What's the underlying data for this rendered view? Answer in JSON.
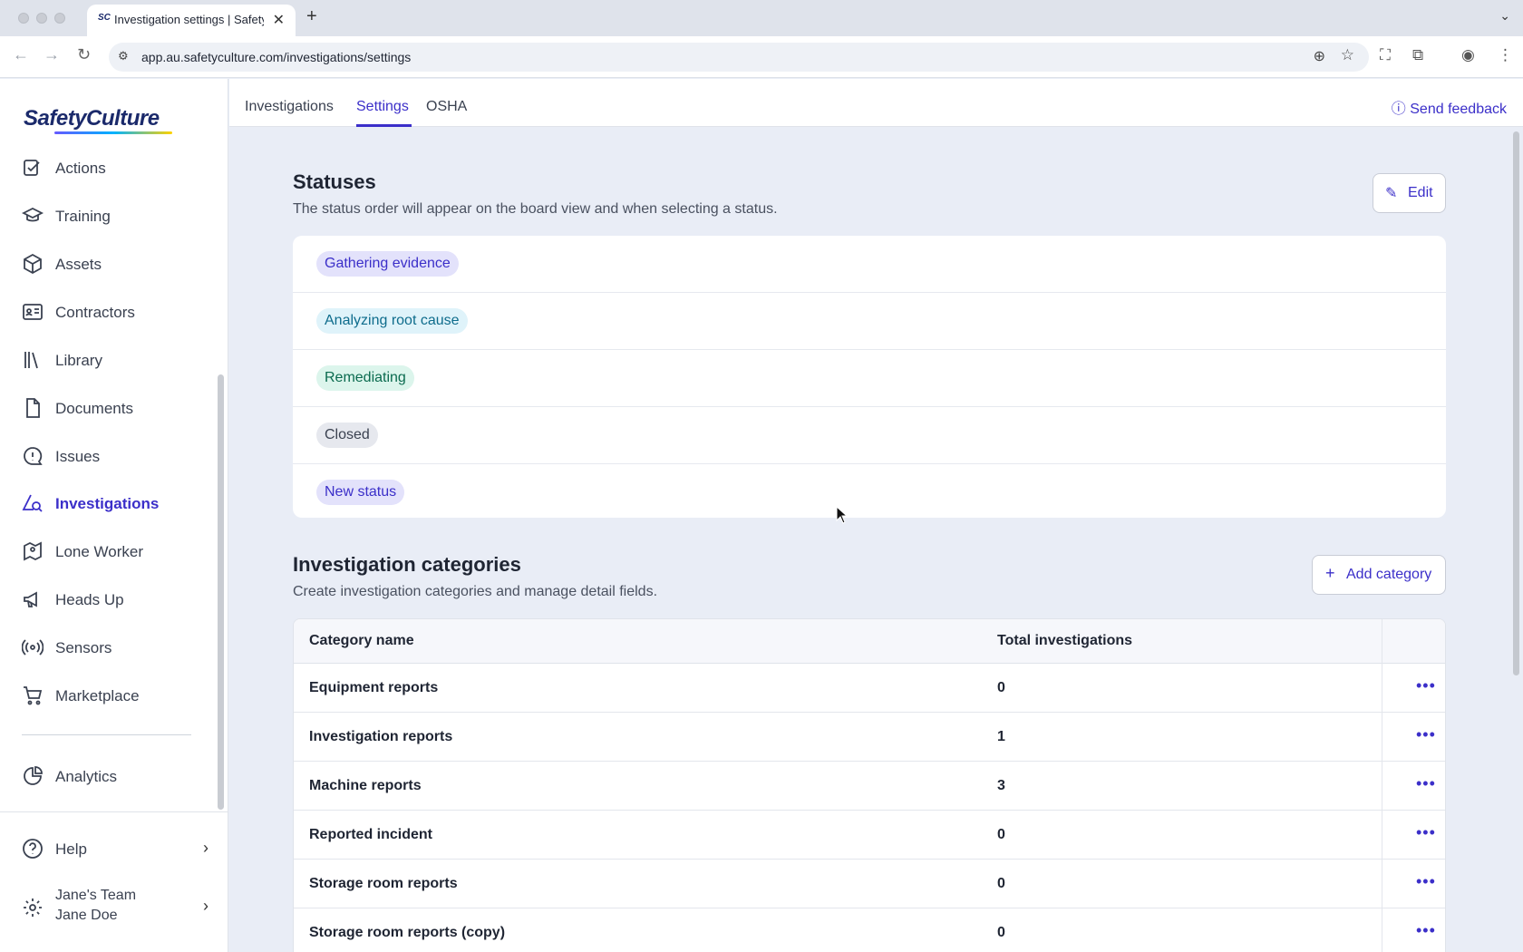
{
  "browser": {
    "tab_title": "Investigation settings | Safety",
    "favicon_text": "SC",
    "url": "app.au.safetyculture.com/investigations/settings"
  },
  "app": {
    "logo": "SafetyCulture",
    "logo_colors": [
      "#6559ff",
      "#00b2ff",
      "#ffd200"
    ],
    "accent_color": "#3b2fc9"
  },
  "sidebar": {
    "items": [
      {
        "label": "Actions",
        "icon": "actions-icon"
      },
      {
        "label": "Training",
        "icon": "graduation-cap-icon"
      },
      {
        "label": "Assets",
        "icon": "cube-icon"
      },
      {
        "label": "Contractors",
        "icon": "id-card-icon"
      },
      {
        "label": "Library",
        "icon": "books-icon"
      },
      {
        "label": "Documents",
        "icon": "document-icon"
      },
      {
        "label": "Issues",
        "icon": "alert-bubble-icon"
      },
      {
        "label": "Investigations",
        "icon": "investigation-icon",
        "active": true
      },
      {
        "label": "Lone Worker",
        "icon": "map-pin-icon"
      },
      {
        "label": "Heads Up",
        "icon": "megaphone-icon"
      },
      {
        "label": "Sensors",
        "icon": "sensor-icon"
      },
      {
        "label": "Marketplace",
        "icon": "cart-icon"
      },
      {
        "label": "Analytics",
        "icon": "pie-chart-icon"
      }
    ],
    "help_label": "Help",
    "team_name": "Jane's Team",
    "user_name": "Jane Doe"
  },
  "topnav": {
    "tabs": [
      "Investigations",
      "Settings",
      "OSHA"
    ],
    "active_tab": "Settings",
    "feedback_label": "Send feedback"
  },
  "statuses": {
    "title": "Statuses",
    "description": "The status order will appear on the board view and when selecting a status.",
    "edit_label": "Edit",
    "items": [
      {
        "label": "Gathering evidence",
        "bg": "#e3e2fb",
        "color": "#3b2fc9"
      },
      {
        "label": "Analyzing root cause",
        "bg": "#dff3fa",
        "color": "#0e6c8c"
      },
      {
        "label": "Remediating",
        "bg": "#dcf5ec",
        "color": "#0b6b4f"
      },
      {
        "label": "Closed",
        "bg": "#e6e8ee",
        "color": "#3a4150"
      },
      {
        "label": "New status",
        "bg": "#e3e2fb",
        "color": "#3b2fc9"
      }
    ]
  },
  "categories": {
    "title": "Investigation categories",
    "description": "Create investigation categories and manage detail fields.",
    "add_label": "Add category",
    "columns": [
      "Category name",
      "Total investigations"
    ],
    "rows": [
      {
        "name": "Equipment reports",
        "total": "0"
      },
      {
        "name": "Investigation reports",
        "total": "1"
      },
      {
        "name": "Machine reports",
        "total": "3"
      },
      {
        "name": "Reported incident",
        "total": "0"
      },
      {
        "name": "Storage room reports",
        "total": "0"
      },
      {
        "name": "Storage room reports (copy)",
        "total": "0"
      }
    ],
    "row_menu_icon": "more-horizontal-icon"
  }
}
